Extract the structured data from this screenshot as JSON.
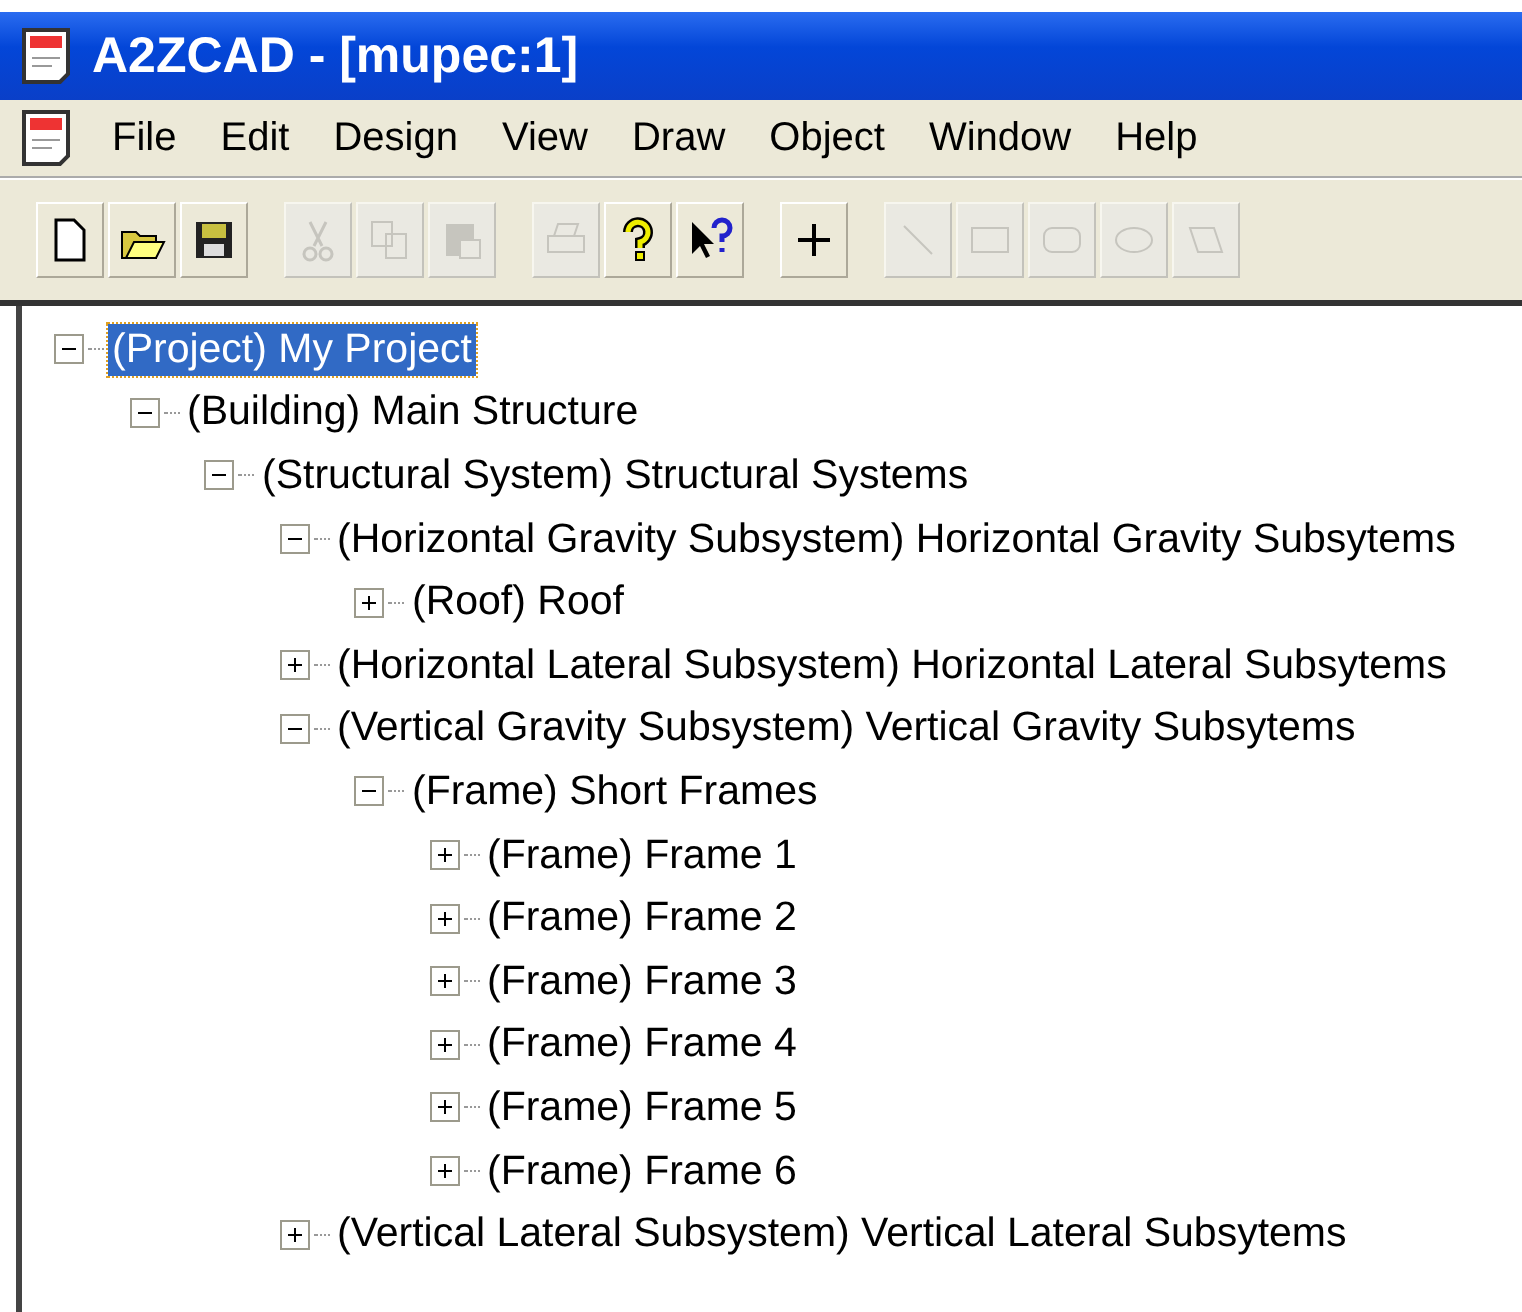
{
  "window": {
    "title": "A2ZCAD - [mupec:1]"
  },
  "menu": [
    "File",
    "Edit",
    "Design",
    "View",
    "Draw",
    "Object",
    "Window",
    "Help"
  ],
  "toolbar": [
    {
      "kind": "new",
      "disabled": false
    },
    {
      "kind": "open",
      "disabled": false
    },
    {
      "kind": "save",
      "disabled": false
    },
    {
      "kind": "sep"
    },
    {
      "kind": "cut",
      "disabled": true
    },
    {
      "kind": "copy",
      "disabled": true
    },
    {
      "kind": "paste",
      "disabled": true
    },
    {
      "kind": "sep"
    },
    {
      "kind": "print",
      "disabled": true
    },
    {
      "kind": "help",
      "disabled": false
    },
    {
      "kind": "context-help",
      "disabled": false
    },
    {
      "kind": "sep"
    },
    {
      "kind": "plus",
      "disabled": false
    },
    {
      "kind": "sep"
    },
    {
      "kind": "line",
      "disabled": true
    },
    {
      "kind": "rect",
      "disabled": true
    },
    {
      "kind": "roundrect",
      "disabled": true
    },
    {
      "kind": "ellipse",
      "disabled": true
    },
    {
      "kind": "polygon",
      "disabled": true
    }
  ],
  "tree": [
    {
      "label": "(Project) My Project",
      "selected": true,
      "expanded": true,
      "children": [
        {
          "label": "(Building) Main Structure",
          "selected": false,
          "expanded": true,
          "children": [
            {
              "label": "(Structural System) Structural Systems",
              "selected": false,
              "expanded": true,
              "children": [
                {
                  "label": "(Horizontal Gravity Subsystem) Horizontal Gravity Subsytems",
                  "selected": false,
                  "expanded": true,
                  "children": [
                    {
                      "label": "(Roof) Roof",
                      "selected": false,
                      "expanded": false
                    }
                  ]
                },
                {
                  "label": "(Horizontal Lateral Subsystem) Horizontal Lateral Subsytems",
                  "selected": false,
                  "expanded": false
                },
                {
                  "label": "(Vertical Gravity Subsystem) Vertical Gravity Subsytems",
                  "selected": false,
                  "expanded": true,
                  "children": [
                    {
                      "label": "(Frame) Short Frames",
                      "selected": false,
                      "expanded": true,
                      "children": [
                        {
                          "label": "(Frame) Frame 1",
                          "selected": false,
                          "expanded": false
                        },
                        {
                          "label": "(Frame) Frame 2",
                          "selected": false,
                          "expanded": false
                        },
                        {
                          "label": "(Frame) Frame 3",
                          "selected": false,
                          "expanded": false
                        },
                        {
                          "label": "(Frame) Frame 4",
                          "selected": false,
                          "expanded": false
                        },
                        {
                          "label": "(Frame) Frame 5",
                          "selected": false,
                          "expanded": false
                        },
                        {
                          "label": "(Frame) Frame 6",
                          "selected": false,
                          "expanded": false
                        }
                      ]
                    }
                  ]
                },
                {
                  "label": "(Vertical Lateral Subsystem) Vertical Lateral Subsytems",
                  "selected": false,
                  "expanded": false
                }
              ]
            }
          ]
        }
      ]
    }
  ]
}
